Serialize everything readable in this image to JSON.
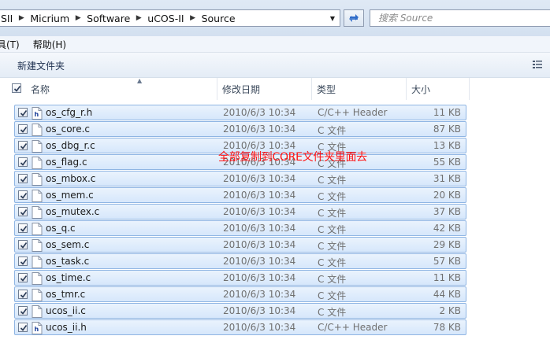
{
  "address_bar": {
    "breadcrumbs": [
      "SII",
      "Micrium",
      "Software",
      "uCOS-II",
      "Source"
    ]
  },
  "search": {
    "placeholder": "搜索 Source"
  },
  "menu": {
    "items": [
      "具(T)",
      "帮助(H)"
    ]
  },
  "command_bar": {
    "new_folder_label": "新建文件夹"
  },
  "columns": {
    "name": "名称",
    "date": "修改日期",
    "type": "类型",
    "size": "大小"
  },
  "files": [
    {
      "name": "os_cfg_r.h",
      "date": "2010/6/3 10:34",
      "type": "C/C++ Header",
      "size": "11 KB",
      "icon": "header-file-icon"
    },
    {
      "name": "os_core.c",
      "date": "2010/6/3 10:34",
      "type": "C 文件",
      "size": "87 KB",
      "icon": "c-file-icon"
    },
    {
      "name": "os_dbg_r.c",
      "date": "2010/6/3 10:34",
      "type": "C 文件",
      "size": "13 KB",
      "icon": "c-file-icon"
    },
    {
      "name": "os_flag.c",
      "date": "2010/6/3 10:34",
      "type": "C 文件",
      "size": "55 KB",
      "icon": "c-file-icon"
    },
    {
      "name": "os_mbox.c",
      "date": "2010/6/3 10:34",
      "type": "C 文件",
      "size": "31 KB",
      "icon": "c-file-icon"
    },
    {
      "name": "os_mem.c",
      "date": "2010/6/3 10:34",
      "type": "C 文件",
      "size": "20 KB",
      "icon": "c-file-icon"
    },
    {
      "name": "os_mutex.c",
      "date": "2010/6/3 10:34",
      "type": "C 文件",
      "size": "37 KB",
      "icon": "c-file-icon"
    },
    {
      "name": "os_q.c",
      "date": "2010/6/3 10:34",
      "type": "C 文件",
      "size": "42 KB",
      "icon": "c-file-icon"
    },
    {
      "name": "os_sem.c",
      "date": "2010/6/3 10:34",
      "type": "C 文件",
      "size": "29 KB",
      "icon": "c-file-icon"
    },
    {
      "name": "os_task.c",
      "date": "2010/6/3 10:34",
      "type": "C 文件",
      "size": "57 KB",
      "icon": "c-file-icon"
    },
    {
      "name": "os_time.c",
      "date": "2010/6/3 10:34",
      "type": "C 文件",
      "size": "11 KB",
      "icon": "c-file-icon"
    },
    {
      "name": "os_tmr.c",
      "date": "2010/6/3 10:34",
      "type": "C 文件",
      "size": "44 KB",
      "icon": "c-file-icon"
    },
    {
      "name": "ucos_ii.c",
      "date": "2010/6/3 10:34",
      "type": "C 文件",
      "size": "2 KB",
      "icon": "c-file-icon"
    },
    {
      "name": "ucos_ii.h",
      "date": "2010/6/3 10:34",
      "type": "C/C++ Header",
      "size": "78 KB",
      "icon": "header-file-icon"
    }
  ],
  "annotation": {
    "text": "全部复制到CORE文件夹里面去"
  },
  "colors": {
    "selection_fill": "#d6e7fb",
    "selection_border": "#8fb5e3",
    "annotation": "#ff1010"
  }
}
